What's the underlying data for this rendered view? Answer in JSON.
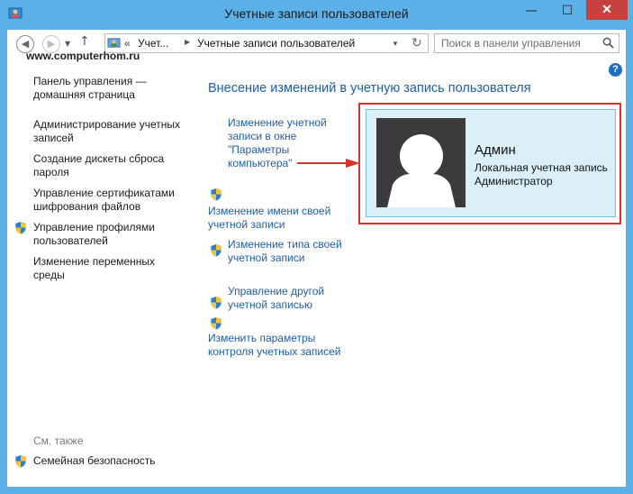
{
  "window": {
    "title": "Учетные записи пользователей",
    "close_label": "✕",
    "minimize_label": "—",
    "maximize_label": "☐"
  },
  "address_bar": {
    "path_overflow": "«",
    "crumbs": [
      "Учет...",
      "Учетные записи пользователей"
    ],
    "search_placeholder": "Поиск в панели управления"
  },
  "watermark": "www.computerhom.ru",
  "sidebar": {
    "home": "Панель управления — домашняя страница",
    "items": [
      "Администрирование учетных записей",
      "Создание дискеты сброса пароля",
      "Управление сертификатами шифрования файлов",
      "Управление профилями пользователей",
      "Изменение переменных среды"
    ],
    "see_also_title": "См. также",
    "see_also_items": [
      "Семейная безопасность"
    ]
  },
  "main": {
    "heading": "Внесение изменений в учетную запись пользователя",
    "links": [
      "Изменение учетной записи в окне \"Параметры компьютера\"",
      "Изменение имени своей учетной записи",
      "Изменение типа своей учетной записи",
      "Управление другой учетной записью",
      "Изменить параметры контроля учетных записей"
    ]
  },
  "account": {
    "name": "Админ",
    "type": "Локальная учетная запись",
    "role": "Администратор"
  },
  "colors": {
    "window_frame": "#5cb0e8",
    "link": "#1e5fa8",
    "highlight_red": "#d8322e",
    "card_bg": "#dbeff9"
  }
}
